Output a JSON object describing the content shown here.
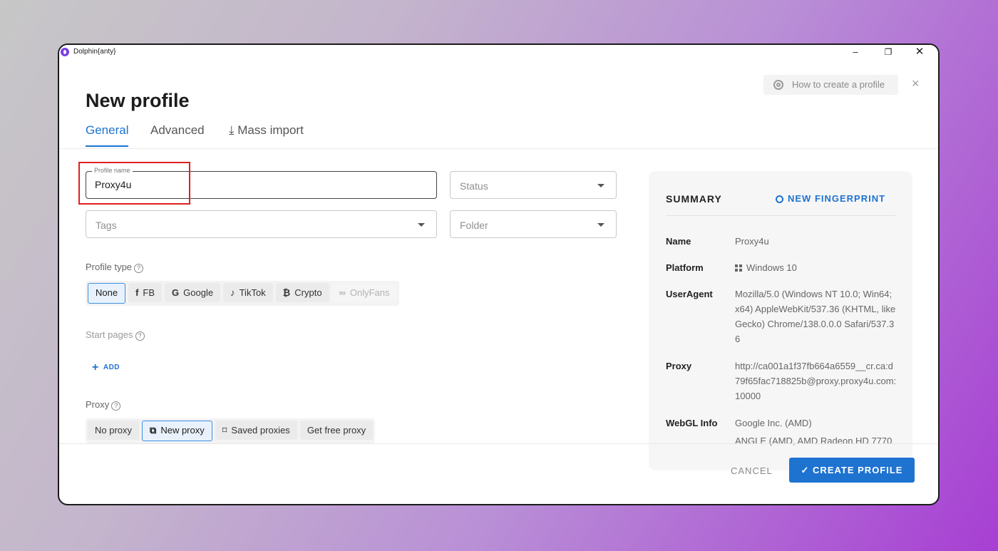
{
  "window": {
    "title": "Dolphin{anty}",
    "minimize": "–",
    "maximize": "❐",
    "close": "✕"
  },
  "header": {
    "title": "New profile",
    "help_label": "How to create a profile",
    "close": "×"
  },
  "tabs": [
    {
      "label": "General",
      "active": true
    },
    {
      "label": "Advanced",
      "active": false
    },
    {
      "label": "Mass import",
      "active": false,
      "icon": "download-icon"
    }
  ],
  "form": {
    "profile_name": {
      "legend": "Profile name",
      "value": "Proxy4u"
    },
    "status": {
      "placeholder": "Status"
    },
    "tags": {
      "placeholder": "Tags"
    },
    "folder": {
      "placeholder": "Folder"
    }
  },
  "profile_type": {
    "label": "Profile type",
    "options": [
      {
        "label": "None",
        "active": true
      },
      {
        "label": "FB",
        "icon": "facebook-icon"
      },
      {
        "label": "Google",
        "icon": "google-icon"
      },
      {
        "label": "TikTok",
        "icon": "tiktok-icon"
      },
      {
        "label": "Crypto",
        "icon": "crypto-icon"
      },
      {
        "label": "OnlyFans",
        "icon": "onlyfans-icon",
        "disabled": true
      }
    ]
  },
  "start_pages": {
    "label": "Start pages",
    "add_label": "ADD"
  },
  "proxy": {
    "label": "Proxy",
    "options": [
      {
        "label": "No proxy"
      },
      {
        "label": "New proxy",
        "active": true,
        "icon": "new-proxy-icon"
      },
      {
        "label": "Saved proxies",
        "icon": "bookmark-icon"
      },
      {
        "label": "Get free proxy"
      }
    ]
  },
  "summary": {
    "title": "SUMMARY",
    "new_fingerprint": "NEW FINGERPRINT",
    "rows": [
      {
        "key": "Name",
        "value": "Proxy4u"
      },
      {
        "key": "Platform",
        "value": "Windows 10"
      },
      {
        "key": "UserAgent",
        "value": "Mozilla/5.0 (Windows NT 10.0; Win64; x64) AppleWebKit/537.36 (KHTML, like Gecko) Chrome/138.0.0.0 Safari/537.36"
      },
      {
        "key": "Proxy",
        "value": "http://ca001a1f37fb664a6559__cr.ca:d79f65fac718825b@proxy.proxy4u.com:10000"
      },
      {
        "key": "WebGL Info",
        "value": "Google Inc. (AMD)",
        "value2": "ANGLE (AMD, AMD Radeon HD 7770"
      }
    ]
  },
  "footer": {
    "cancel": "CANCEL",
    "create": "CREATE PROFILE"
  },
  "colors": {
    "accent": "#1e73d1",
    "highlight": "#e02020"
  }
}
